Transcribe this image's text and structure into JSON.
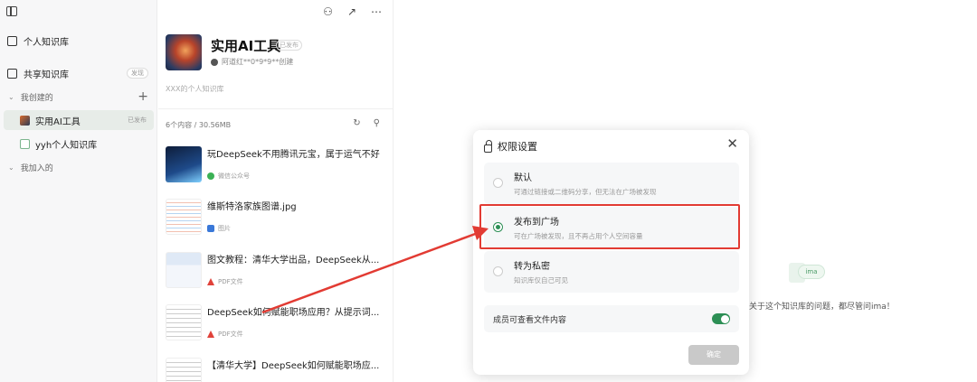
{
  "sidebar": {
    "personal_kb": "个人知识库",
    "shared_kb": "共享知识库",
    "shared_tag": "发现",
    "my_created": "我创建的",
    "kbs": [
      {
        "name": "实用AI工具",
        "tag": "已发布"
      },
      {
        "name": "yyh个人知识库"
      }
    ],
    "my_joined": "我加入的"
  },
  "kb": {
    "title": "实用AI工具",
    "title_tag": "已发布",
    "creator": "阿道红**0*9*9**创建",
    "description": "XXX的个人知识库",
    "count": "6个内容 / 30.56MB"
  },
  "items": [
    {
      "title": "玩DeepSeek不用腾讯元宝，属于运气不好",
      "source": "微信公众号"
    },
    {
      "title": "维斯特洛家族图谱.jpg",
      "source": "图片"
    },
    {
      "title": "图文教程：清华大学出品，DeepSeek从...",
      "source": "PDF文件"
    },
    {
      "title": "DeepSeek如何赋能职场应用？从提示词...",
      "source": "PDF文件"
    },
    {
      "title": "【清华大学】DeepSeek如何赋能职场应..."
    }
  ],
  "empty_state": {
    "logo_text": "ima",
    "hint": "关于这个知识库的问题，都尽管问ima！"
  },
  "dialog": {
    "title": "权限设置",
    "options": [
      {
        "label": "默认",
        "desc": "可通过链接或二维码分享，但无法在广场被发现"
      },
      {
        "label": "发布到广场",
        "desc": "可在广场被发现，且不再占用个人空间容量"
      },
      {
        "label": "转为私密",
        "desc": "知识库仅自己可见"
      }
    ],
    "toggle_label": "成员可查看文件内容",
    "confirm": "确定"
  }
}
